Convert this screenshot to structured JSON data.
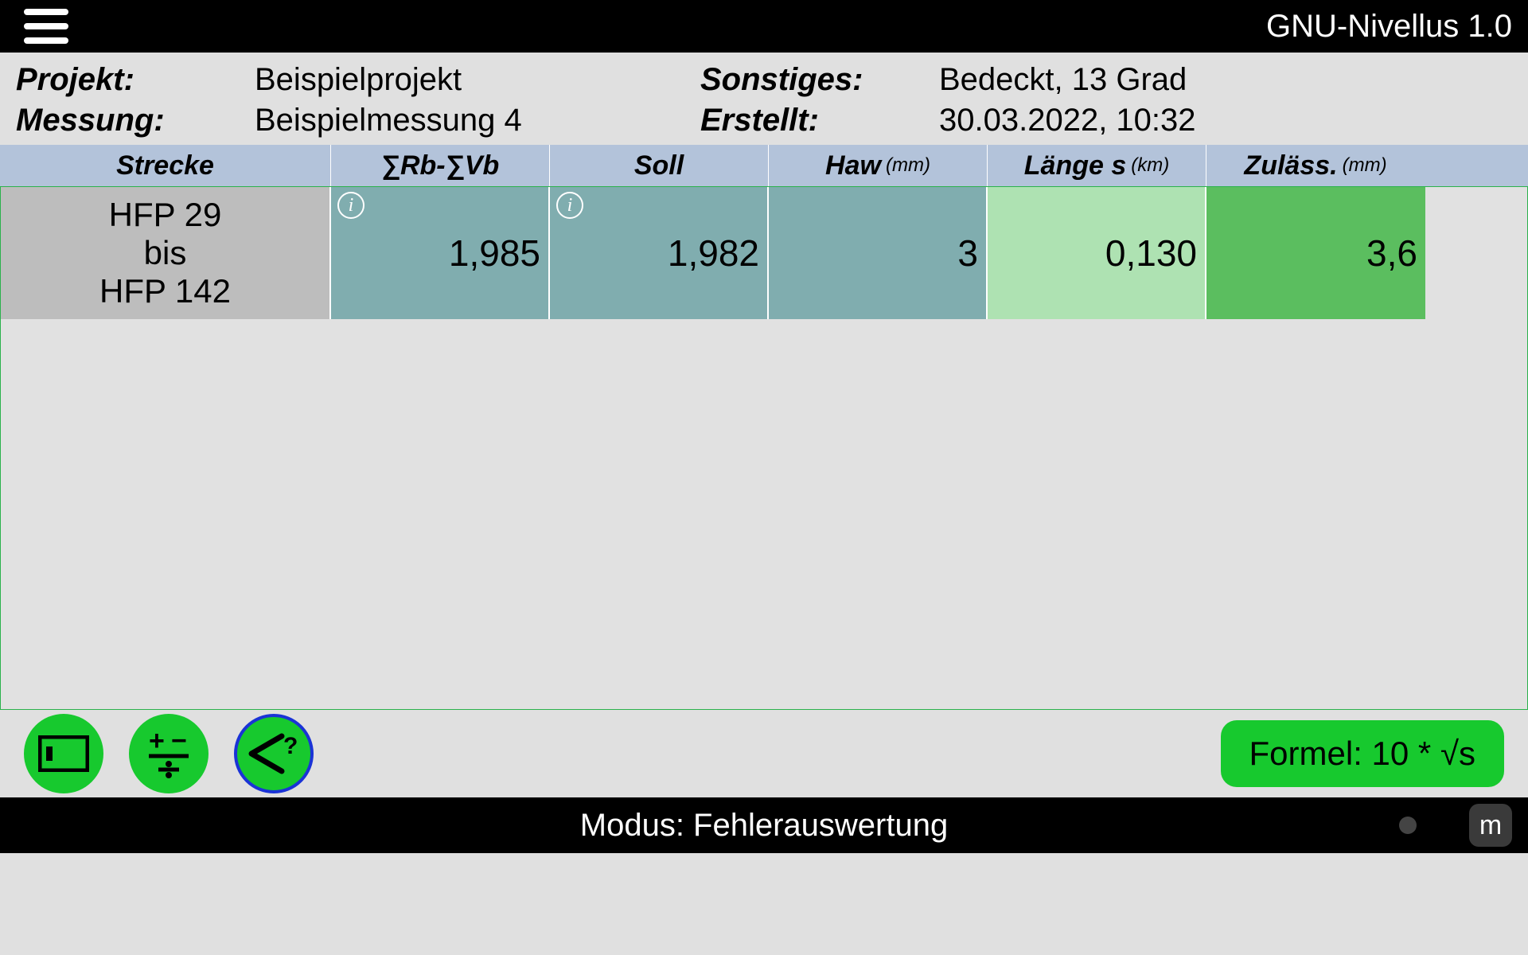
{
  "header": {
    "app_title": "GNU-Nivellus 1.0"
  },
  "meta": {
    "project_label": "Projekt:",
    "project_value": "Beispielprojekt",
    "measurement_label": "Messung:",
    "measurement_value": "Beispielmessung 4",
    "other_label": "Sonstiges:",
    "other_value": "Bedeckt, 13 Grad",
    "created_label": "Erstellt:",
    "created_value": "30.03.2022, 10:32"
  },
  "columns": {
    "c0": "Strecke",
    "c1": "∑Rb-∑Vb",
    "c2": "Soll",
    "c3": "Haw",
    "c3_unit": "(mm)",
    "c4": "Länge s",
    "c4_unit": "(km)",
    "c5": "Zuläss.",
    "c5_unit": "(mm)"
  },
  "rows": [
    {
      "strecke_line1": "HFP 29",
      "strecke_line2": "bis",
      "strecke_line3": "HFP 142",
      "rb_vb": "1,985",
      "soll": "1,982",
      "haw": "3",
      "laenge": "0,130",
      "zulass": "3,6"
    }
  ],
  "toolbar": {
    "formula_label": "Formel: 10 * √s"
  },
  "footer": {
    "mode_label": "Modus: Fehlerauswertung",
    "m": "m"
  }
}
